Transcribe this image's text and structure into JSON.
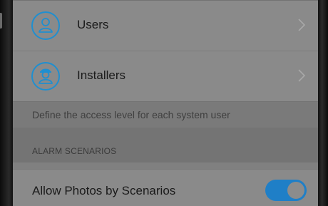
{
  "users_row": {
    "label": "Users",
    "icon": "user-icon"
  },
  "installers_row": {
    "label": "Installers",
    "icon": "installer-icon"
  },
  "access_note": "Define the access level for each system user",
  "alarm_section": {
    "header": "ALARM SCENARIOS",
    "allow_photos": {
      "label": "Allow Photos by Scenarios",
      "enabled": true
    }
  },
  "colors": {
    "accent": "#1f8fd0",
    "toggle_on": "#1f7fc7",
    "row_bg": "#8a8a8a",
    "section_bg": "#747474"
  }
}
